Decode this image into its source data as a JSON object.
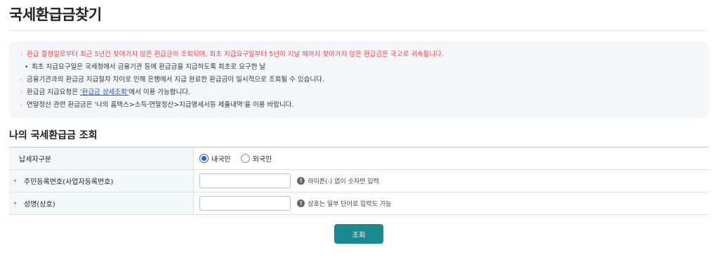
{
  "page": {
    "title": "국세환급금찾기"
  },
  "notice": {
    "items": [
      {
        "text": "환급 결정일로부터 최근 5년간 찾아가지 않은 환급금이 조회되며, 최초 지급요구일부터 5년이 지날 때까지 찾아가지 않은 환급금은 국고로 귀속됩니다."
      },
      {
        "text": "최초 지급요구일은 국세청에서 금융기관 등에 환급금을 지급하도록 최초로 요구한 날"
      },
      {
        "text": "금융기관과의 환급금 지급절차 차이로 인해 은행에서 지급 완료한 환급금이 일시적으로 조회될 수 있습니다."
      },
      {
        "prefix": "환급금 지급요청은 ",
        "link": "'환급금 상세조회'",
        "suffix": "에서 이용 가능합니다."
      },
      {
        "text": "연말정산 관련 환급금은 '나의 홈택스>소득·연말정산>지급명세서등 제출내역'을 이용 바랍니다."
      }
    ],
    "bullet": "·",
    "sub_bullet": "•"
  },
  "form": {
    "section_title": "나의 국세환급금 조회",
    "required_mark": "*",
    "taxpayer_type": {
      "label": "납세자구분",
      "options": [
        {
          "label": "내국인",
          "selected": true
        },
        {
          "label": "외국인",
          "selected": false
        }
      ]
    },
    "id_number": {
      "label": "주민등록번호(사업자등록번호)",
      "value": "",
      "hint": "하이픈(-) 없이 숫자만 입력"
    },
    "name": {
      "label": "성명(상호)",
      "value": "",
      "hint": "상호는 일부 단어로 입력도 가능"
    },
    "info_icon": "!",
    "submit_label": "조회"
  },
  "colors": {
    "accent": "#1a8a90",
    "warning": "#e24a4a",
    "link": "#1a56c4",
    "radio": "#2a62c9"
  }
}
